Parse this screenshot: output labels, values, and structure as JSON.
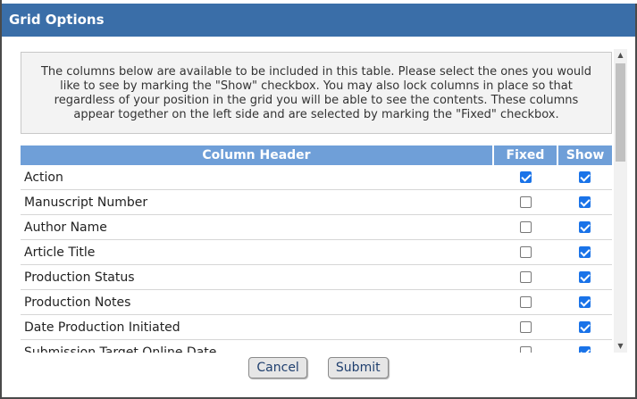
{
  "dialog": {
    "title": "Grid Options"
  },
  "instructions": "The columns below are available to be included in this table. Please select the ones you would like to see by marking the \"Show\" checkbox. You may also lock columns in place so that regardless of your position in the grid you will be able to see the contents. These columns appear together on the left side and are selected by marking the \"Fixed\" checkbox.",
  "grid": {
    "headers": {
      "column_header": "Column Header",
      "fixed": "Fixed",
      "show": "Show"
    },
    "rows": [
      {
        "label": "Action",
        "fixed": true,
        "show": true
      },
      {
        "label": "Manuscript Number",
        "fixed": false,
        "show": true
      },
      {
        "label": "Author Name",
        "fixed": false,
        "show": true
      },
      {
        "label": "Article Title",
        "fixed": false,
        "show": true
      },
      {
        "label": "Production Status",
        "fixed": false,
        "show": true
      },
      {
        "label": "Production Notes",
        "fixed": false,
        "show": true
      },
      {
        "label": "Date Production Initiated",
        "fixed": false,
        "show": true
      },
      {
        "label": "Submission Target Online Date",
        "fixed": false,
        "show": true
      }
    ]
  },
  "buttons": {
    "cancel": "Cancel",
    "submit": "Submit"
  },
  "colors": {
    "titlebar": "#3a6ea8",
    "header": "#6f9fd8",
    "checkbox_checked": "#1a73e8"
  }
}
